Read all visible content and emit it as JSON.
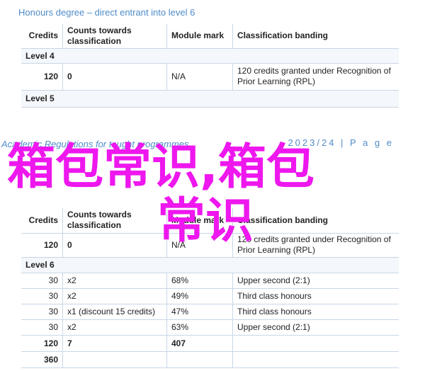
{
  "top": {
    "heading": "Honours degree – direct entrant into level 6",
    "headers": {
      "credits": "Credits",
      "counts": "Counts towards classification",
      "mark": "Module mark",
      "banding": "Classification banding"
    },
    "level4": "Level 4",
    "row1": {
      "credits": "120",
      "counts": "0",
      "mark": "N/A",
      "banding": "120 credits granted under Recognition of Prior Learning (RPL)"
    },
    "level5": "Level 5"
  },
  "footer": {
    "left": "Academic Regulations for taught programmes",
    "right": "2023/24 | P a g e"
  },
  "bottom": {
    "headers": {
      "credits": "Credits",
      "counts": "Counts towards classification",
      "mark": "Module mark",
      "banding": "Classification banding"
    },
    "row1": {
      "credits": "120",
      "counts": "0",
      "mark": "N/A",
      "banding": "120 credits granted under Recognition of Prior Learning (RPL)"
    },
    "level6": "Level 6",
    "rows": [
      {
        "credits": "30",
        "counts": "x2",
        "mark": "68%",
        "banding": "Upper second (2:1)"
      },
      {
        "credits": "30",
        "counts": "x2",
        "mark": "49%",
        "banding": "Third class honours"
      },
      {
        "credits": "30",
        "counts": "x1 (discount 15 credits)",
        "mark": "47%",
        "banding": "Third class honours"
      },
      {
        "credits": "30",
        "counts": "x2",
        "mark": "63%",
        "banding": "Upper second (2:1)"
      }
    ],
    "total": {
      "credits": "120",
      "counts": "7",
      "mark": "407"
    },
    "grand_total": {
      "credits": "360"
    }
  },
  "overlay": {
    "line1": "箱包常识,箱包",
    "line2": "常识"
  }
}
